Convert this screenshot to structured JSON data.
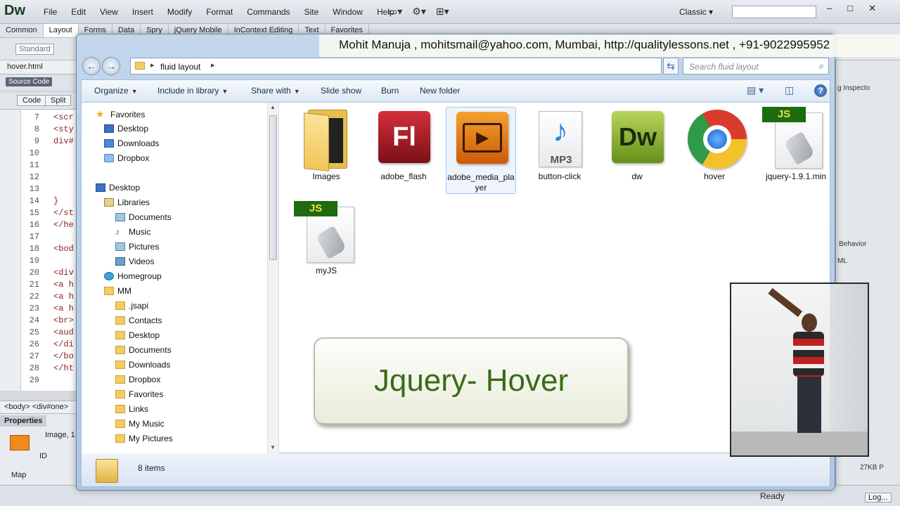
{
  "dreamweaver": {
    "logo": "Dw",
    "menu": [
      "File",
      "Edit",
      "View",
      "Insert",
      "Modify",
      "Format",
      "Commands",
      "Site",
      "Window",
      "Help"
    ],
    "workspace": "Classic",
    "insert_tabs": [
      "Common",
      "Layout",
      "Forms",
      "Data",
      "Spry",
      "jQuery Mobile",
      "InContext Editing",
      "Text",
      "Favorites"
    ],
    "insert_active": "Layout",
    "standard_label": "Standard",
    "doc_tab": "hover.html",
    "source_code": "Source Code",
    "view_code": "Code",
    "view_split": "Split",
    "code_lines": [
      {
        "num": "7",
        "text": "<scr"
      },
      {
        "num": "8",
        "text": "<sty"
      },
      {
        "num": "9",
        "text": "div#"
      },
      {
        "num": "10",
        "text": ""
      },
      {
        "num": "11",
        "text": ""
      },
      {
        "num": "12",
        "text": ""
      },
      {
        "num": "13",
        "text": ""
      },
      {
        "num": "14",
        "text": "}"
      },
      {
        "num": "15",
        "text": "</st"
      },
      {
        "num": "16",
        "text": "</he"
      },
      {
        "num": "17",
        "text": ""
      },
      {
        "num": "18",
        "text": "<bod"
      },
      {
        "num": "19",
        "text": ""
      },
      {
        "num": "20",
        "text": "<div"
      },
      {
        "num": "21",
        "text": "<a h"
      },
      {
        "num": "22",
        "text": "<a h"
      },
      {
        "num": "23",
        "text": "<a h"
      },
      {
        "num": "24",
        "text": "<br>"
      },
      {
        "num": "25",
        "text": "<aud"
      },
      {
        "num": "26",
        "text": "</di"
      },
      {
        "num": "27",
        "text": "</bo"
      },
      {
        "num": "28",
        "text": "</ht"
      },
      {
        "num": "29",
        "text": ""
      }
    ],
    "tag_selector": "<body> <div#one>",
    "properties_title": "Properties",
    "properties_image": "Image, 1",
    "properties_id": "ID",
    "properties_map": "Map",
    "right_panel": {
      "inspector": "g Inspecto",
      "behaviors": "Behavior",
      "ml": "ML",
      "size": "27KB P"
    },
    "status": "Ready",
    "log": "Log..."
  },
  "explorer": {
    "breadcrumb": "fluid layout",
    "search_placeholder": "Search fluid layout",
    "commands": [
      "Organize",
      "Include in library",
      "Share with",
      "Slide show",
      "Burn",
      "New folder"
    ],
    "nav": {
      "favorites": "Favorites",
      "favorites_items": [
        "Desktop",
        "Downloads",
        "Dropbox"
      ],
      "desktop": "Desktop",
      "libraries": "Libraries",
      "libraries_items": [
        "Documents",
        "Music",
        "Pictures",
        "Videos"
      ],
      "homegroup": "Homegroup",
      "user": "MM",
      "user_items": [
        ".jsapi",
        "Contacts",
        "Desktop",
        "Documents",
        "Downloads",
        "Dropbox",
        "Favorites",
        "Links",
        "My Music",
        "My Pictures"
      ]
    },
    "files": [
      {
        "name": "Images",
        "icon": "folder-icon"
      },
      {
        "name": "adobe_flash",
        "icon": "flash-icon",
        "label": "Fl"
      },
      {
        "name": "adobe_media_player",
        "icon": "media-player-icon"
      },
      {
        "name": "button-click",
        "icon": "mp3-icon",
        "label": "MP3"
      },
      {
        "name": "dw",
        "icon": "dreamweaver-icon",
        "label": "Dw"
      },
      {
        "name": "hover",
        "icon": "chrome-icon"
      },
      {
        "name": "jquery-1.9.1.min",
        "icon": "js-file-icon",
        "label": "JS"
      },
      {
        "name": "myJS",
        "icon": "js-file-icon",
        "label": "JS"
      }
    ],
    "selected_file": "adobe_media_player",
    "item_count": "8 items"
  },
  "overlay": {
    "banner": "Mohit  Manuja , mohitsmail@yahoo.com, Mumbai, http://qualitylessons.net , +91-9022995952",
    "hover_button": "Jquery- Hover"
  },
  "colors": {
    "accent": "#3a6b1a",
    "explorer_frame": "#aec6e2"
  }
}
